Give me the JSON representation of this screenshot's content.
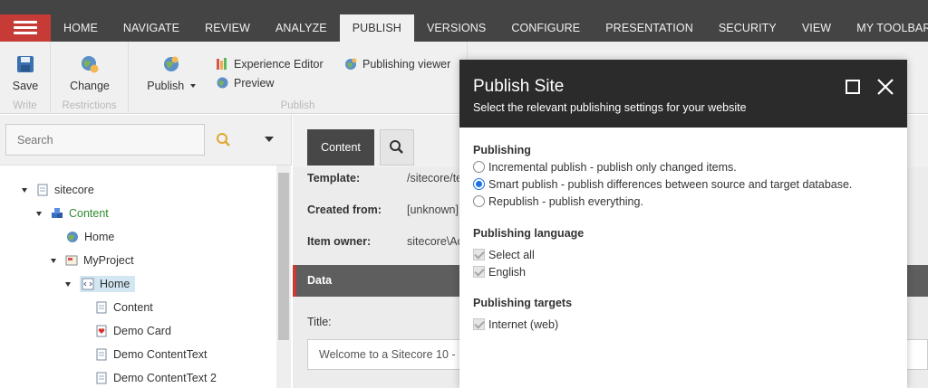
{
  "nav": {
    "tabs": [
      "HOME",
      "NAVIGATE",
      "REVIEW",
      "ANALYZE",
      "PUBLISH",
      "VERSIONS",
      "CONFIGURE",
      "PRESENTATION",
      "SECURITY",
      "VIEW",
      "MY TOOLBAR"
    ],
    "active_tab": "PUBLISH",
    "accent_color": "#c63b36"
  },
  "ribbon": {
    "write": {
      "save_label": "Save",
      "group_label": "Write"
    },
    "restrictions": {
      "change_label": "Change",
      "group_label": "Restrictions"
    },
    "publish": {
      "publish_label": "Publish",
      "experience_editor_label": "Experience Editor",
      "preview_label": "Preview",
      "publishing_viewer_label": "Publishing viewer",
      "group_label": "Publish"
    }
  },
  "search": {
    "placeholder": "Search"
  },
  "tree": {
    "items": [
      {
        "label": "sitecore",
        "icon": "document-icon"
      },
      {
        "label": "Content",
        "icon": "cubes-icon"
      },
      {
        "label": "Home",
        "icon": "globe-icon"
      },
      {
        "label": "MyProject",
        "icon": "folder-icon"
      },
      {
        "label": "Home",
        "icon": "code-page-icon"
      },
      {
        "label": "Content",
        "icon": "document-icon"
      },
      {
        "label": "Demo Card",
        "icon": "heart-card-icon"
      },
      {
        "label": "Demo ContentText",
        "icon": "document-icon"
      },
      {
        "label": "Demo ContentText 2",
        "icon": "document-icon"
      }
    ]
  },
  "editor": {
    "tab_label": "Content",
    "fields": [
      {
        "label": "Template:",
        "value": "/sitecore/te"
      },
      {
        "label": "Created from:",
        "value": "[unknown]"
      },
      {
        "label": "Item owner:",
        "value": "sitecore\\Ad"
      }
    ],
    "section_label": "Data",
    "title_label": "Title:",
    "title_value": "Welcome to a Sitecore 10 - ."
  },
  "dialog": {
    "title": "Publish Site",
    "subtitle": "Select the relevant publishing settings for your website",
    "publishing": {
      "heading": "Publishing",
      "options": [
        "Incremental publish - publish only changed items.",
        "Smart publish - publish differences between source and target database.",
        "Republish - publish everything."
      ],
      "selected_index": 1
    },
    "language": {
      "heading": "Publishing language",
      "options": [
        "Select all",
        "English"
      ]
    },
    "targets": {
      "heading": "Publishing targets",
      "options": [
        "Internet (web)"
      ]
    }
  }
}
